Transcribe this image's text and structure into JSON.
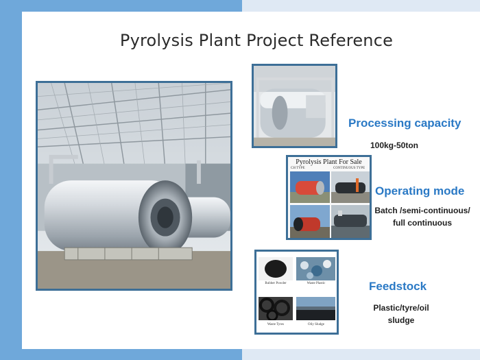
{
  "title": "Pyrolysis Plant Project Reference",
  "features": [
    {
      "heading": "Processing capacity",
      "text_lines": [
        "100kg-50ton"
      ]
    },
    {
      "heading": "Operating mode",
      "text_lines": [
        "Batch /semi-continuous/",
        "full continuous"
      ]
    },
    {
      "heading": "Feedstock",
      "text_lines": [
        "Plastic/tyre/oil",
        "sludge"
      ]
    }
  ],
  "collage_mid": {
    "title": "Pyrolysis Plant For Sale",
    "left_tag": "CH TYPE",
    "right_tag": "CONTINUOUS TYPE"
  },
  "collage_bot": {
    "captions": [
      "Rubber Powder",
      "Waste Plastic",
      "Waste Tyres",
      "Oily Sludge"
    ]
  },
  "colors": {
    "accent": "#2a79c5",
    "frame": "#3d6f97",
    "left_band": "#6fa8da"
  }
}
